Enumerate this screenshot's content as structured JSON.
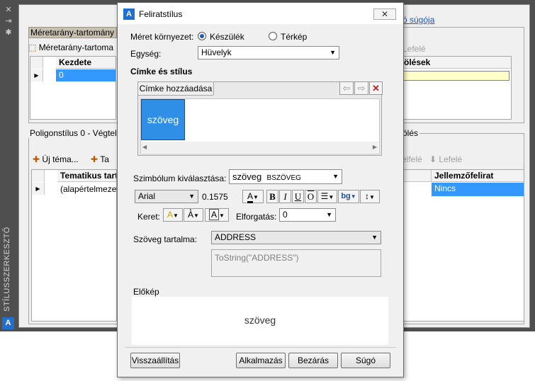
{
  "palette": {
    "side_title": "STÍLUSSZERKESZTŐ",
    "help_link": "ó súgója",
    "scale_tab": "Méretarány-tartomány",
    "scale_toolbar_label": "Méretarány-tartoma",
    "scale_toolbar_right": "Lefelé",
    "scale_col_start": "Kezdete",
    "scale_row_value": "0",
    "scale_col_right": "ölések",
    "poly_title": "Poligonstílus 0 - Végtel",
    "poly_right_title": "ölés",
    "poly_toolbar_new": "Új téma...",
    "poly_toolbar_2": "Ta",
    "poly_toolbar_up": "elfelé",
    "poly_toolbar_down": "Lefelé",
    "poly_col_theme": "Tematikus tart",
    "poly_row_value": "(alapértelmezet",
    "poly_col_label": "Jellemzőfelirat",
    "poly_label_value": "Nincs"
  },
  "dialog": {
    "title": "Feliratstílus",
    "close": "✕",
    "size_env_label": "Méret környezet:",
    "radio_device": "Készülék",
    "radio_map": "Térkép",
    "unit_label": "Egység:",
    "unit_value": "Hüvelyk",
    "label_style_title": "Címke és stílus",
    "add_label_btn": "Címke hozzáadása",
    "label_tile_text": "szöveg",
    "symbol_label": "Szimbólum kiválasztása:",
    "symbol_value_main": "szöveg",
    "symbol_value_sub": "BSZÖVEG",
    "font_value": "Arial",
    "size_value": "0.1575",
    "border_label": "Keret:",
    "rotation_label": "Elforgatás:",
    "rotation_value": "0",
    "content_label": "Szöveg tartalma:",
    "content_value": "ADDRESS",
    "expression": "ToString(\"ADDRESS\")",
    "preview_label": "Előkép",
    "preview_text": "szöveg",
    "btn_reset": "Visszaállítás",
    "btn_apply": "Alkalmazás",
    "btn_close": "Bezárás",
    "btn_help": "Súgó"
  }
}
